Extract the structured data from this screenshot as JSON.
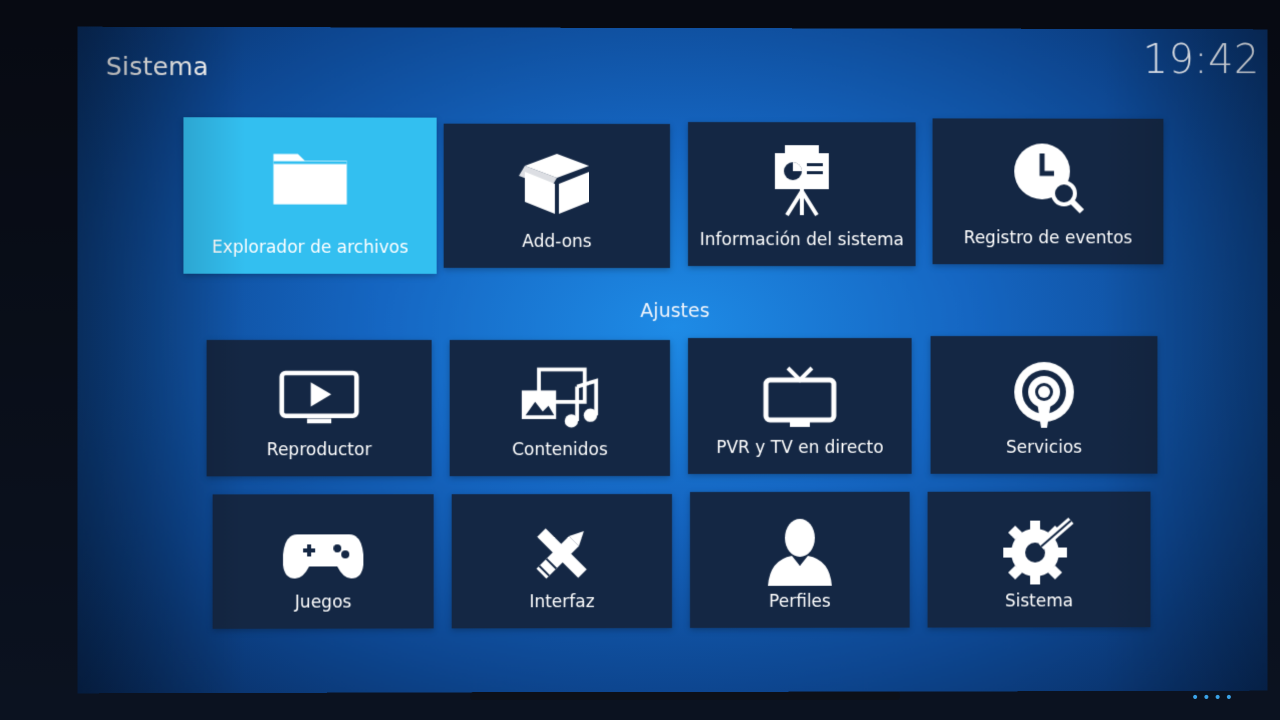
{
  "header": {
    "title": "Sistema",
    "clock": "19:42"
  },
  "colors": {
    "tile_bg": "#142744",
    "focused_bg": "#33bff0",
    "screen_bg": "#1566c2"
  },
  "top_row": [
    {
      "label": "Explorador de archivos",
      "icon": "folder-icon",
      "focused": true
    },
    {
      "label": "Add-ons",
      "icon": "box-icon"
    },
    {
      "label": "Información del sistema",
      "icon": "presentation-icon"
    },
    {
      "label": "Registro de eventos",
      "icon": "clock-search-icon"
    }
  ],
  "section": {
    "label": "Ajustes"
  },
  "settings": [
    {
      "label": "Reproductor",
      "icon": "play-monitor-icon"
    },
    {
      "label": "Contenidos",
      "icon": "media-icon"
    },
    {
      "label": "PVR y TV en directo",
      "icon": "tv-icon"
    },
    {
      "label": "Servicios",
      "icon": "broadcast-icon"
    },
    {
      "label": "Juegos",
      "icon": "gamepad-icon"
    },
    {
      "label": "Interfaz",
      "icon": "pencil-ruler-icon"
    },
    {
      "label": "Perfiles",
      "icon": "user-icon"
    },
    {
      "label": "Sistema",
      "icon": "gear-wrench-icon"
    }
  ]
}
